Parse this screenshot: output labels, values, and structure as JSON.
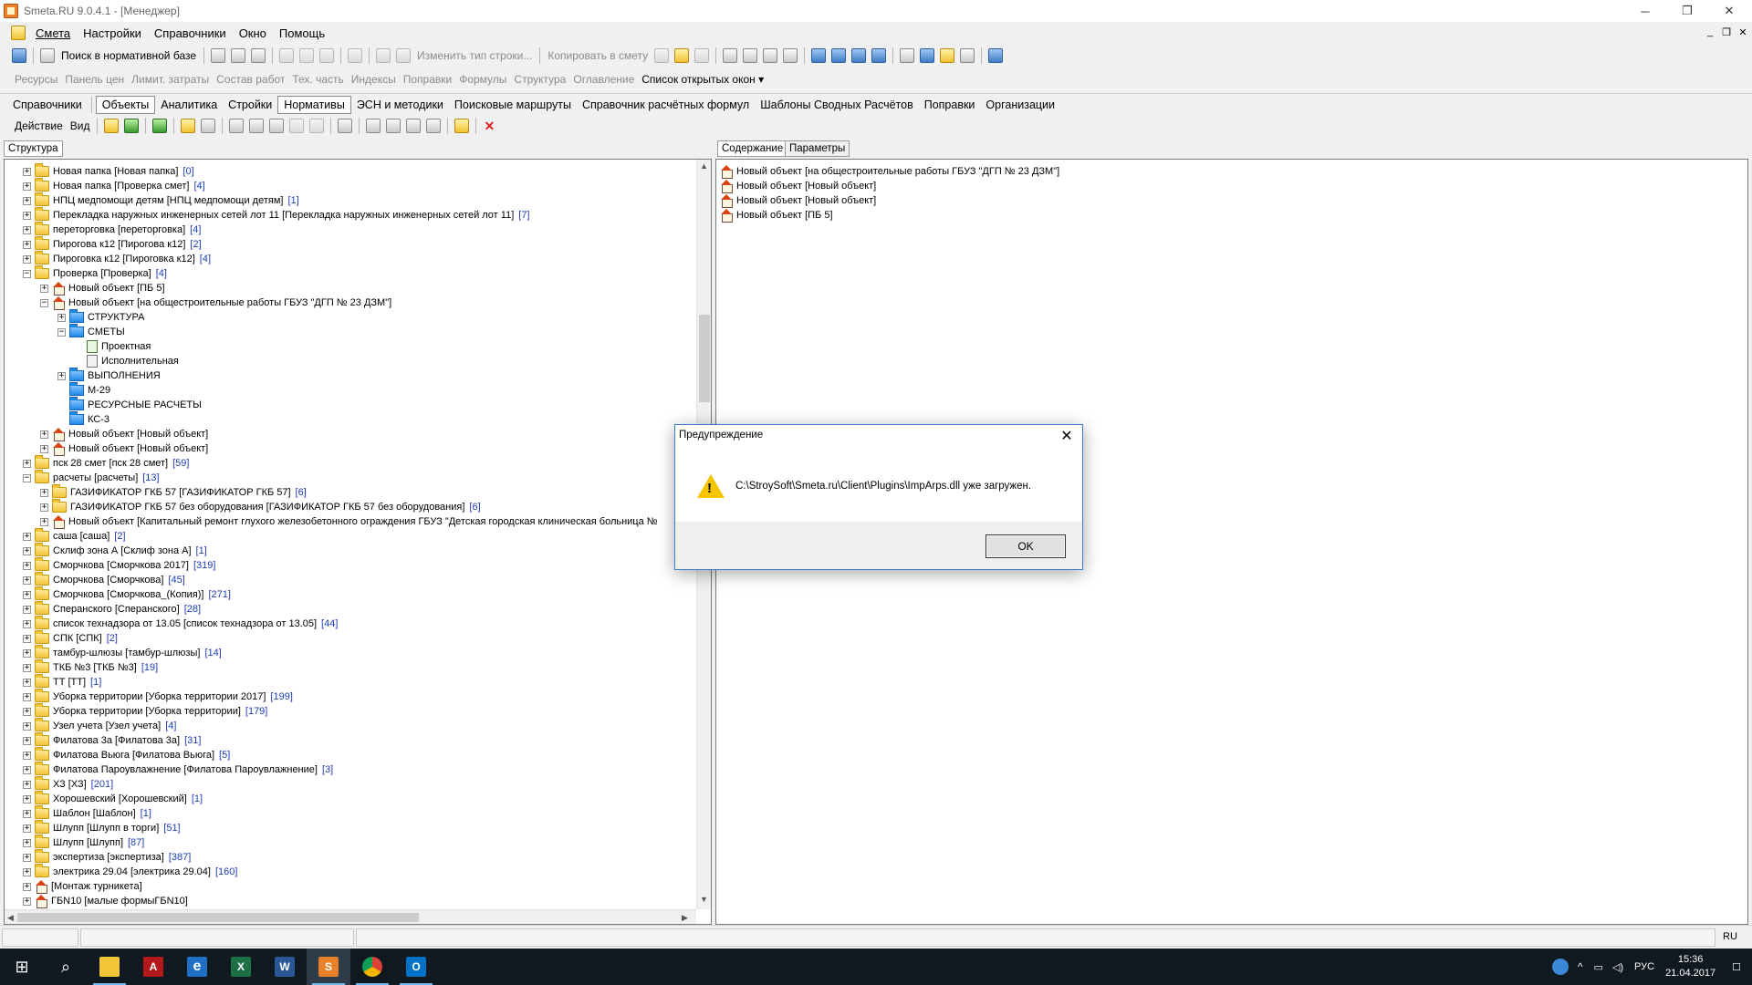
{
  "app": {
    "title": "Smeta.RU  9.0.4.1  - [Менеджер]",
    "minimize": "─",
    "maximize": "❐",
    "close": "✕"
  },
  "menu": [
    "Смета",
    "Настройки",
    "Справочники",
    "Окно",
    "Помощь"
  ],
  "mdi": {
    "minimize": "_",
    "restore": "❐",
    "close": "✕"
  },
  "toolbar1": {
    "search_label": "Поиск в нормативной базе",
    "change_type_label": "Изменить тип строки...",
    "copy_label": "Копировать в смету"
  },
  "toolbar2": {
    "items": [
      "Ресурсы",
      "Панель цен",
      "Лимит. затраты",
      "Состав работ",
      "Тех. часть",
      "Индексы",
      "Поправки",
      "Формулы",
      "Структура",
      "Оглавление"
    ],
    "window_list": "Список открытых окон",
    "dropdown_glyph": "▾"
  },
  "tabs": [
    "Справочники",
    "Объекты",
    "Аналитика",
    "Стройки",
    "Нормативы",
    "ЭСН и методики",
    "Поисковые маршруты",
    "Справочник расчётных формул",
    "Шаблоны Сводных Расчётов",
    "Поправки",
    "Организации"
  ],
  "toolbar4": {
    "action": "Действие",
    "view": "Вид"
  },
  "left_tabs": [
    "Структура"
  ],
  "right_tabs": [
    "Содержание",
    "Параметры"
  ],
  "tree": [
    {
      "level": 0,
      "exp": "+",
      "icon": "folder",
      "text": "Новая папка [Новая папка]",
      "count": "[0]"
    },
    {
      "level": 0,
      "exp": "+",
      "icon": "folder",
      "text": "Новая папка [Проверка смет]",
      "count": "[4]"
    },
    {
      "level": 0,
      "exp": "+",
      "icon": "folder",
      "text": "НПЦ медпомощи детям [НПЦ медпомощи детям]",
      "count": "[1]"
    },
    {
      "level": 0,
      "exp": "+",
      "icon": "folder",
      "text": "Перекладка наружных инженерных сетей лот 11 [Перекладка наружных инженерных сетей лот 11]",
      "count": "[7]"
    },
    {
      "level": 0,
      "exp": "+",
      "icon": "folder",
      "text": "переторговка [переторговка]",
      "count": "[4]"
    },
    {
      "level": 0,
      "exp": "+",
      "icon": "folder",
      "text": "Пирогова к12 [Пирогова к12]",
      "count": "[2]"
    },
    {
      "level": 0,
      "exp": "+",
      "icon": "folder",
      "text": "Пироговка к12 [Пироговка к12]",
      "count": "[4]"
    },
    {
      "level": 0,
      "exp": "−",
      "icon": "folder",
      "text": "Проверка [Проверка]",
      "count": "[4]"
    },
    {
      "level": 1,
      "exp": "+",
      "icon": "house",
      "text": "Новый объект [ПБ 5]",
      "count": ""
    },
    {
      "level": 1,
      "exp": "−",
      "icon": "house",
      "text": "Новый объект [на общестроительные работы ГБУЗ \"ДГП № 23 ДЗМ\"]",
      "count": ""
    },
    {
      "level": 2,
      "exp": "+",
      "icon": "bfolder",
      "text": "СТРУКТУРА",
      "count": ""
    },
    {
      "level": 2,
      "exp": "−",
      "icon": "bfolder",
      "text": "СМЕТЫ",
      "count": ""
    },
    {
      "level": 3,
      "exp": "",
      "icon": "doc",
      "text": "Проектная",
      "count": ""
    },
    {
      "level": 3,
      "exp": "",
      "icon": "docgray",
      "text": "Исполнительная",
      "count": ""
    },
    {
      "level": 2,
      "exp": "+",
      "icon": "bfolder",
      "text": "ВЫПОЛНЕНИЯ",
      "count": ""
    },
    {
      "level": 2,
      "exp": "",
      "icon": "bfolder",
      "text": "М-29",
      "count": ""
    },
    {
      "level": 2,
      "exp": "",
      "icon": "bfolder",
      "text": "РЕСУРСНЫЕ РАСЧЕТЫ",
      "count": ""
    },
    {
      "level": 2,
      "exp": "",
      "icon": "bfolder",
      "text": "КС-3",
      "count": ""
    },
    {
      "level": 1,
      "exp": "+",
      "icon": "house",
      "text": "Новый объект [Новый объект]",
      "count": ""
    },
    {
      "level": 1,
      "exp": "+",
      "icon": "house",
      "text": "Новый объект [Новый объект]",
      "count": ""
    },
    {
      "level": 0,
      "exp": "+",
      "icon": "folder",
      "text": "пск 28 смет [пск 28 смет]",
      "count": "[59]"
    },
    {
      "level": 0,
      "exp": "−",
      "icon": "folder",
      "text": "расчеты [расчеты]",
      "count": "[13]"
    },
    {
      "level": 1,
      "exp": "+",
      "icon": "folder",
      "text": "ГАЗИФИКАТОР ГКБ 57 [ГАЗИФИКАТОР ГКБ 57]",
      "count": "[6]"
    },
    {
      "level": 1,
      "exp": "+",
      "icon": "folder",
      "text": "ГАЗИФИКАТОР ГКБ 57 без оборудования [ГАЗИФИКАТОР ГКБ 57 без оборудования]",
      "count": "[6]"
    },
    {
      "level": 1,
      "exp": "+",
      "icon": "house",
      "text": "Новый объект [Капитальный ремонт глухого железобетонного ограждения ГБУЗ \"Детская городская клиническая больница №",
      "count": ""
    },
    {
      "level": 0,
      "exp": "+",
      "icon": "folder",
      "text": "саша [саша]",
      "count": "[2]"
    },
    {
      "level": 0,
      "exp": "+",
      "icon": "folder",
      "text": "Склиф зона А [Склиф зона А]",
      "count": "[1]"
    },
    {
      "level": 0,
      "exp": "+",
      "icon": "folder",
      "text": "Сморчкова [Сморчкова 2017]",
      "count": "[319]"
    },
    {
      "level": 0,
      "exp": "+",
      "icon": "folder",
      "text": "Сморчкова [Сморчкова]",
      "count": "[45]"
    },
    {
      "level": 0,
      "exp": "+",
      "icon": "folder",
      "text": "Сморчкова [Сморчкова_(Копия)]",
      "count": "[271]"
    },
    {
      "level": 0,
      "exp": "+",
      "icon": "folder",
      "text": "Сперанского [Сперанского]",
      "count": "[28]"
    },
    {
      "level": 0,
      "exp": "+",
      "icon": "folder",
      "text": "список технадзора от 13.05 [список технадзора от 13.05]",
      "count": "[44]"
    },
    {
      "level": 0,
      "exp": "+",
      "icon": "folder",
      "text": "СПК [СПК]",
      "count": "[2]"
    },
    {
      "level": 0,
      "exp": "+",
      "icon": "folder",
      "text": "тамбур-шлюзы [тамбур-шлюзы]",
      "count": "[14]"
    },
    {
      "level": 0,
      "exp": "+",
      "icon": "folder",
      "text": "ТКБ №3 [ТКБ №3]",
      "count": "[19]"
    },
    {
      "level": 0,
      "exp": "+",
      "icon": "folder",
      "text": "ТТ [ТТ]",
      "count": "[1]"
    },
    {
      "level": 0,
      "exp": "+",
      "icon": "folder",
      "text": "Уборка территории [Уборка территории 2017]",
      "count": "[199]"
    },
    {
      "level": 0,
      "exp": "+",
      "icon": "folder",
      "text": "Уборка территории [Уборка территории]",
      "count": "[179]"
    },
    {
      "level": 0,
      "exp": "+",
      "icon": "folder",
      "text": "Узел учета [Узел учета]",
      "count": "[4]"
    },
    {
      "level": 0,
      "exp": "+",
      "icon": "folder",
      "text": "Филатова 3а [Филатова 3а]",
      "count": "[31]"
    },
    {
      "level": 0,
      "exp": "+",
      "icon": "folder",
      "text": "Филатова Вьюга [Филатова Вьюга]",
      "count": "[5]"
    },
    {
      "level": 0,
      "exp": "+",
      "icon": "folder",
      "text": "Филатова Пароувлажнение [Филатова Пароувлажнение]",
      "count": "[3]"
    },
    {
      "level": 0,
      "exp": "+",
      "icon": "folder",
      "text": "ХЗ [ХЗ]",
      "count": "[201]"
    },
    {
      "level": 0,
      "exp": "+",
      "icon": "folder",
      "text": "Хорошевский [Хорошевский]",
      "count": "[1]"
    },
    {
      "level": 0,
      "exp": "+",
      "icon": "folder",
      "text": "Шаблон [Шаблон]",
      "count": "[1]"
    },
    {
      "level": 0,
      "exp": "+",
      "icon": "folder",
      "text": "Шлупп [Шлупп в торги]",
      "count": "[51]"
    },
    {
      "level": 0,
      "exp": "+",
      "icon": "folder",
      "text": "Шлупп [Шлупп]",
      "count": "[87]"
    },
    {
      "level": 0,
      "exp": "+",
      "icon": "folder",
      "text": "экспертиза [экспертиза]",
      "count": "[387]"
    },
    {
      "level": 0,
      "exp": "+",
      "icon": "folder",
      "text": "электрика 29.04 [электрика 29.04]",
      "count": "[160]"
    },
    {
      "level": 0,
      "exp": "+",
      "icon": "house",
      "text": "[Монтаж турникета]",
      "count": ""
    },
    {
      "level": 0,
      "exp": "+",
      "icon": "house",
      "text": "ГБN10 [малые формыГБN10]",
      "count": ""
    }
  ],
  "content": [
    "Новый объект [на общестроительные работы ГБУЗ \"ДГП № 23 ДЗМ\"]",
    "Новый объект [Новый объект]",
    "Новый объект [Новый объект]",
    "Новый объект [ПБ 5]"
  ],
  "scroll_glyphs": {
    "up": "▲",
    "down": "▼",
    "left": "◀",
    "right": "▶"
  },
  "dialog": {
    "title": "Предупреждение",
    "close": "✕",
    "warn_mark": "!",
    "message": "C:\\StroySoft\\Smeta.ru\\Client\\Plugins\\ImpArps.dll уже загружен.",
    "ok": "OK"
  },
  "status": {
    "lang": "RU"
  },
  "taskbar": {
    "apps": [
      "windows-start",
      "search",
      "file-explorer",
      "acrobat",
      "edge",
      "excel",
      "word",
      "smeta",
      "chrome",
      "outlook"
    ],
    "start_glyph": "⊞",
    "search_glyph": "⌕",
    "smeta_glyph": "S",
    "excel_glyph": "X",
    "word_glyph": "W",
    "acrobat_glyph": "A",
    "edge_glyph": "e",
    "outlook_glyph": "O",
    "time": "15:36",
    "date": "21.04.2017",
    "lang": "РУС",
    "tray_up": "^",
    "net_glyph": "▭",
    "sound_glyph": "◁)",
    "notif_glyph": "☐"
  },
  "colors": {
    "link_count": "#1a3fb5",
    "dialog_border": "#3d7fc9",
    "taskbar": "#101820"
  }
}
